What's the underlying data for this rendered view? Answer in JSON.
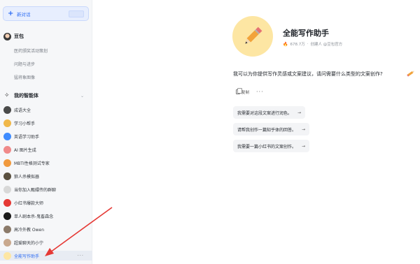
{
  "sidebar": {
    "new_chat_label": "新对话",
    "doubao_label": "豆包",
    "history": [
      "医药颁奖活动策划",
      "问题与进步",
      "猛将象图像"
    ],
    "agents_header": "我的智能体",
    "agents": [
      {
        "label": "成语大全",
        "color": "#4a4a4a"
      },
      {
        "label": "学习小帮手",
        "color": "#f0b84a"
      },
      {
        "label": "英语学习助手",
        "color": "#3f8cff"
      },
      {
        "label": "AI 图片生成",
        "color": "#f08a8a"
      },
      {
        "label": "MBTI性格测试专家",
        "color": "#f19a3e"
      },
      {
        "label": "狼人杀模拟器",
        "color": "#5a5040"
      },
      {
        "label": "当你加入甄嬛传的群聊",
        "color": "#d8d8d8"
      },
      {
        "label": "小红书爆款大师",
        "color": "#e53935"
      },
      {
        "label": "单人剧本杀-鬼畜森念",
        "color": "#1a1a1a"
      },
      {
        "label": "高冷外教 Owen",
        "color": "#8b7a6a"
      },
      {
        "label": "超爱聊天的小宁",
        "color": "#c9a98e"
      },
      {
        "label": "全能写作助手",
        "color": "#fde6a3"
      }
    ],
    "active_more": "···"
  },
  "bot": {
    "name": "全能写作助手",
    "stats": "678.7万",
    "creator": "创建人 @豆包官方",
    "greeting": "我可以为你提供写作灵感或文案建议，请问需要什么类型的文案创作?",
    "copy_label": "复制",
    "more_label": "···",
    "suggestions": [
      "我需要对这段文案进行润色。",
      "请帮我创作一篇知乎体的回答。",
      "我需要一篇小红书的文案创作。"
    ],
    "arrow": "→"
  },
  "colors": {
    "accent": "#2b6bf3",
    "annotation_arrow": "#e53935",
    "avatar_bg": "#fde6a3"
  }
}
